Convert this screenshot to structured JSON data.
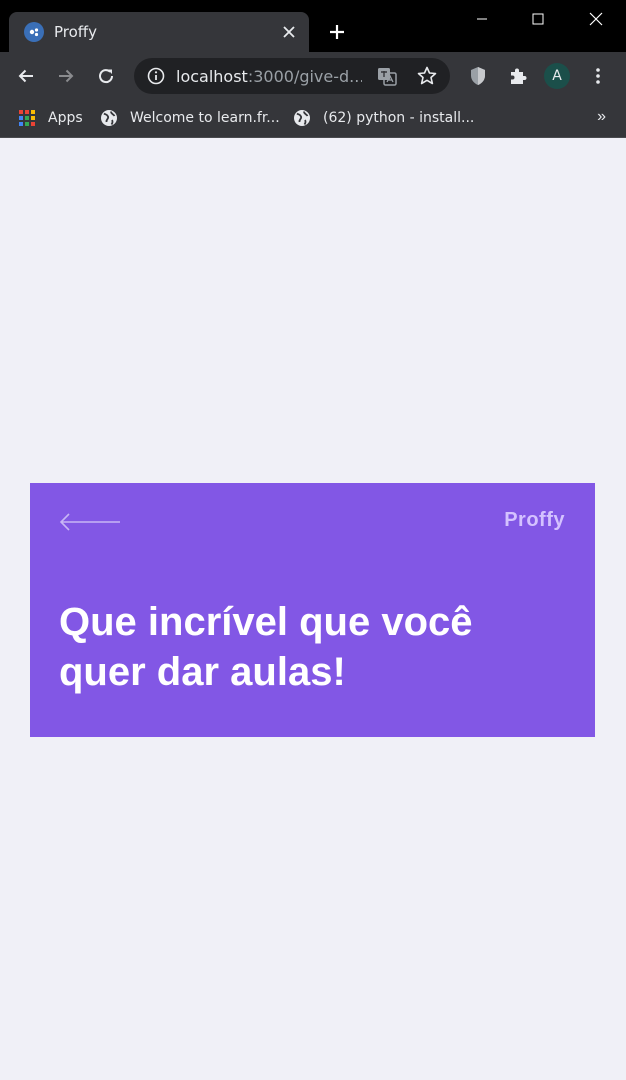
{
  "browser": {
    "tab": {
      "title": "Proffy"
    },
    "address_bar": {
      "host": "localhost",
      "path": ":3000/give-d..."
    },
    "profile_initial": "A",
    "bookmarks": [
      {
        "label": "Apps",
        "icon": "apps-grid-icon"
      },
      {
        "label": "Welcome to learn.fr...",
        "icon": "globe-icon"
      },
      {
        "label": "(62) python - install...",
        "icon": "globe-icon"
      }
    ],
    "bookmarks_overflow": "»"
  },
  "page": {
    "brand": "Proffy",
    "headline": "Que incrível que você quer dar aulas!",
    "colors": {
      "primary": "#8257e5",
      "background": "#f0f0f7",
      "brand_text": "#d4c2ff"
    }
  }
}
